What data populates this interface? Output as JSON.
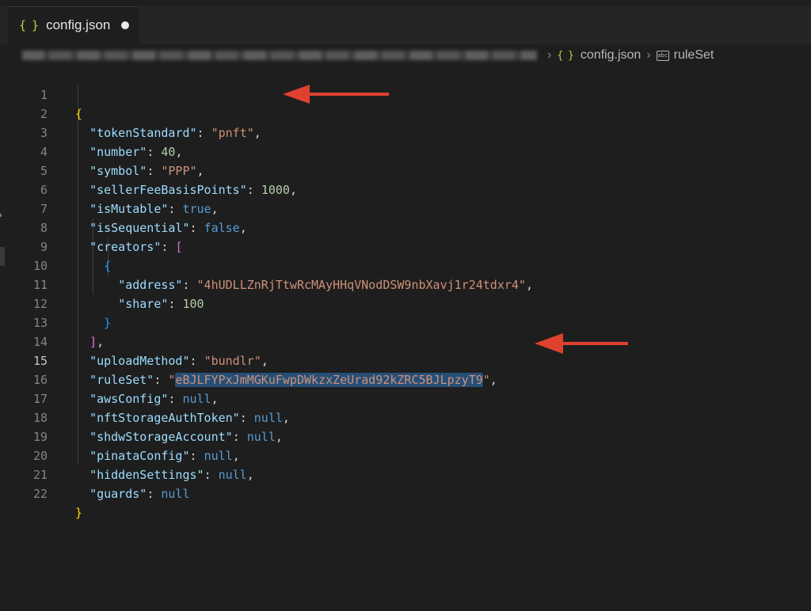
{
  "tab": {
    "icon": "{ }",
    "title": "config.json",
    "modified": true
  },
  "breadcrumb": {
    "file_icon": "{ }",
    "file": "config.json",
    "symbol_icon": "abc",
    "symbol": "ruleSet"
  },
  "editor": {
    "active_line": 15,
    "lines": [
      {
        "num": "1"
      },
      {
        "num": "2"
      },
      {
        "num": "3"
      },
      {
        "num": "4"
      },
      {
        "num": "5"
      },
      {
        "num": "6"
      },
      {
        "num": "7"
      },
      {
        "num": "8"
      },
      {
        "num": "9"
      },
      {
        "num": "10"
      },
      {
        "num": "11"
      },
      {
        "num": "12"
      },
      {
        "num": "13"
      },
      {
        "num": "14"
      },
      {
        "num": "15"
      },
      {
        "num": "16"
      },
      {
        "num": "17"
      },
      {
        "num": "18"
      },
      {
        "num": "19"
      },
      {
        "num": "20"
      },
      {
        "num": "21"
      },
      {
        "num": "22"
      }
    ],
    "tokens": {
      "tokenStandard_key": "\"tokenStandard\"",
      "tokenStandard_val": "\"pnft\"",
      "number_key": "\"number\"",
      "number_val": "40",
      "symbol_key": "\"symbol\"",
      "symbol_val": "\"PPP\"",
      "sfbp_key": "\"sellerFeeBasisPoints\"",
      "sfbp_val": "1000",
      "isMutable_key": "\"isMutable\"",
      "isMutable_val": "true",
      "isSequential_key": "\"isSequential\"",
      "isSequential_val": "false",
      "creators_key": "\"creators\"",
      "address_key": "\"address\"",
      "address_val": "\"4hUDLLZnRjTtwRcMAyHHqVNodDSW9nbXavj1r24tdxr4\"",
      "share_key": "\"share\"",
      "share_val": "100",
      "uploadMethod_key": "\"uploadMethod\"",
      "uploadMethod_val": "\"bundlr\"",
      "ruleSet_key": "\"ruleSet\"",
      "ruleSet_val": "eBJLFYPxJmMGKuFwpDWkzxZeUrad92kZRC5BJLpzyT9",
      "awsConfig_key": "\"awsConfig\"",
      "nftStorage_key": "\"nftStorageAuthToken\"",
      "shdw_key": "\"shdwStorageAccount\"",
      "pinata_key": "\"pinataConfig\"",
      "hidden_key": "\"hiddenSettings\"",
      "guards_key": "\"guards\"",
      "null": "null"
    }
  },
  "annotations": {
    "arrow_color": "#e0412f"
  },
  "colors": {
    "background": "#1e1e1e",
    "key": "#9cdcfe",
    "string": "#ce9178",
    "number": "#b5cea8",
    "keyword": "#569cd6",
    "selection": "#264f78"
  }
}
